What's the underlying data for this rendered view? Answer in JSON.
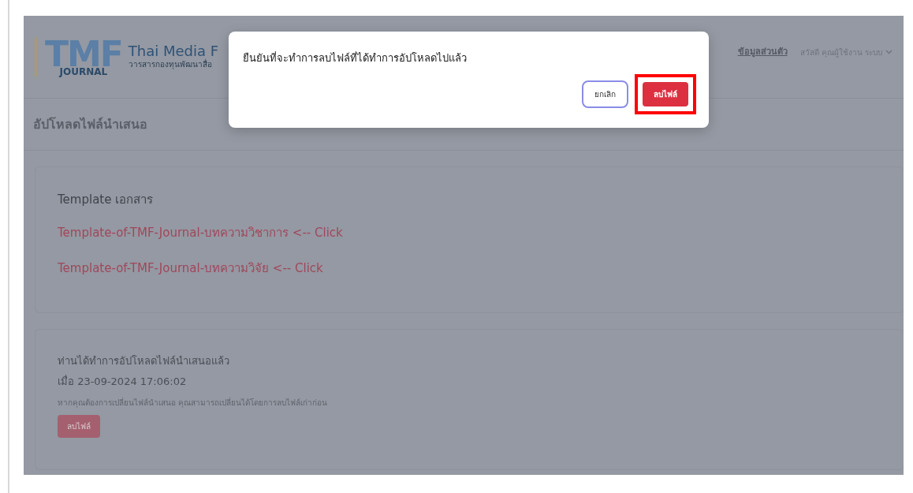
{
  "navbar": {
    "logo_mark": "TMF",
    "logo_journal": "JOURNAL",
    "logo_title": "Thai Media F",
    "logo_subtitle": "วารสารกองทุนพัฒนาสื่อ",
    "profile_link": "ข้อมูลส่วนตัว",
    "user_menu": "สวัสดี คุณผู้ใช้งาน ระบบ"
  },
  "page_title": "อัปโหลดไฟล์นำเสนอ",
  "template_card": {
    "title": "Template เอกสาร",
    "links": [
      {
        "label": "Template-of-TMF-Journal-บทความวิชาการ <-- Click"
      },
      {
        "label": "Template-of-TMF-Journal-บทความวิจัย <-- Click"
      }
    ]
  },
  "upload_card": {
    "message": "ท่านได้ทำการอัปโหลดไฟล์นำเสนอแล้ว",
    "timestamp": "เมื่อ 23-09-2024 17:06:02",
    "hint": "หากคุณต้องการเปลี่ยนไฟล์นำเสนอ คุณสามารถเปลี่ยนได้โดยการลบไฟล์เก่าก่อน",
    "delete_button": "ลบไฟล์"
  },
  "modal": {
    "message": "ยืนยันที่จะทำการลบไฟล์ที่ได้ทำการอัปโหลดไปแล้ว",
    "buttons": [
      {
        "label": "ยกเลิก",
        "kind": "cancel",
        "highlighted": false
      },
      {
        "label": "ลบไฟล์",
        "kind": "confirm",
        "highlighted": true
      }
    ]
  }
}
